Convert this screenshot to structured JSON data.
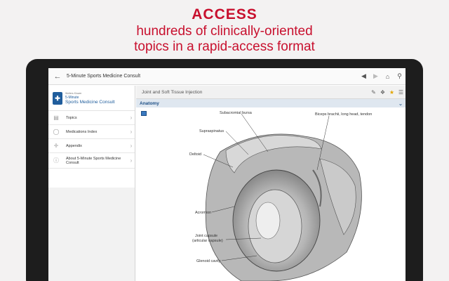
{
  "promo": {
    "headline": "ACCESS",
    "line1": "hundreds of clinically-oriented",
    "line2": "topics in a rapid-access format"
  },
  "appbar": {
    "back_icon": "back-arrow-icon",
    "title": "5-Minute Sports Medicine Consult",
    "icons": [
      "prev-icon",
      "next-icon",
      "home-icon",
      "search-icon"
    ]
  },
  "sidebar": {
    "brand": {
      "publisher": "Wolters Kluwer",
      "five_minute": "5-Minute",
      "name": "Sports Medicine Consult"
    },
    "items": [
      {
        "label": "Topics",
        "icon": "topics-icon"
      },
      {
        "label": "Medications Index",
        "icon": "pill-icon"
      },
      {
        "label": "Appendix",
        "icon": "appendix-icon"
      },
      {
        "label": "About 5-Minute Sports Medicine Consult",
        "icon": "info-icon"
      }
    ]
  },
  "content": {
    "title": "Joint and Soft Tissue Injection",
    "header_icons": [
      "notes-icon",
      "tag-icon",
      "star-icon",
      "list-edit-icon"
    ],
    "section": "Anatomy",
    "figure_labels": {
      "subacromial": "Subacromial bursa",
      "biceps": "Biceps brachii, long head, tendon",
      "supraspinatus": "Supraspinatus",
      "deltoid": "Deltoid",
      "acromion": "Acromion",
      "joint_capsule_1": "Joint capsule",
      "joint_capsule_2": "(articular capsule)",
      "glenoid": "Glenoid cavity"
    }
  },
  "colors": {
    "brand_red": "#c8102e",
    "brand_blue": "#1f5d9c",
    "section_blue": "#1d4f86",
    "star_yellow": "#e3a500"
  }
}
